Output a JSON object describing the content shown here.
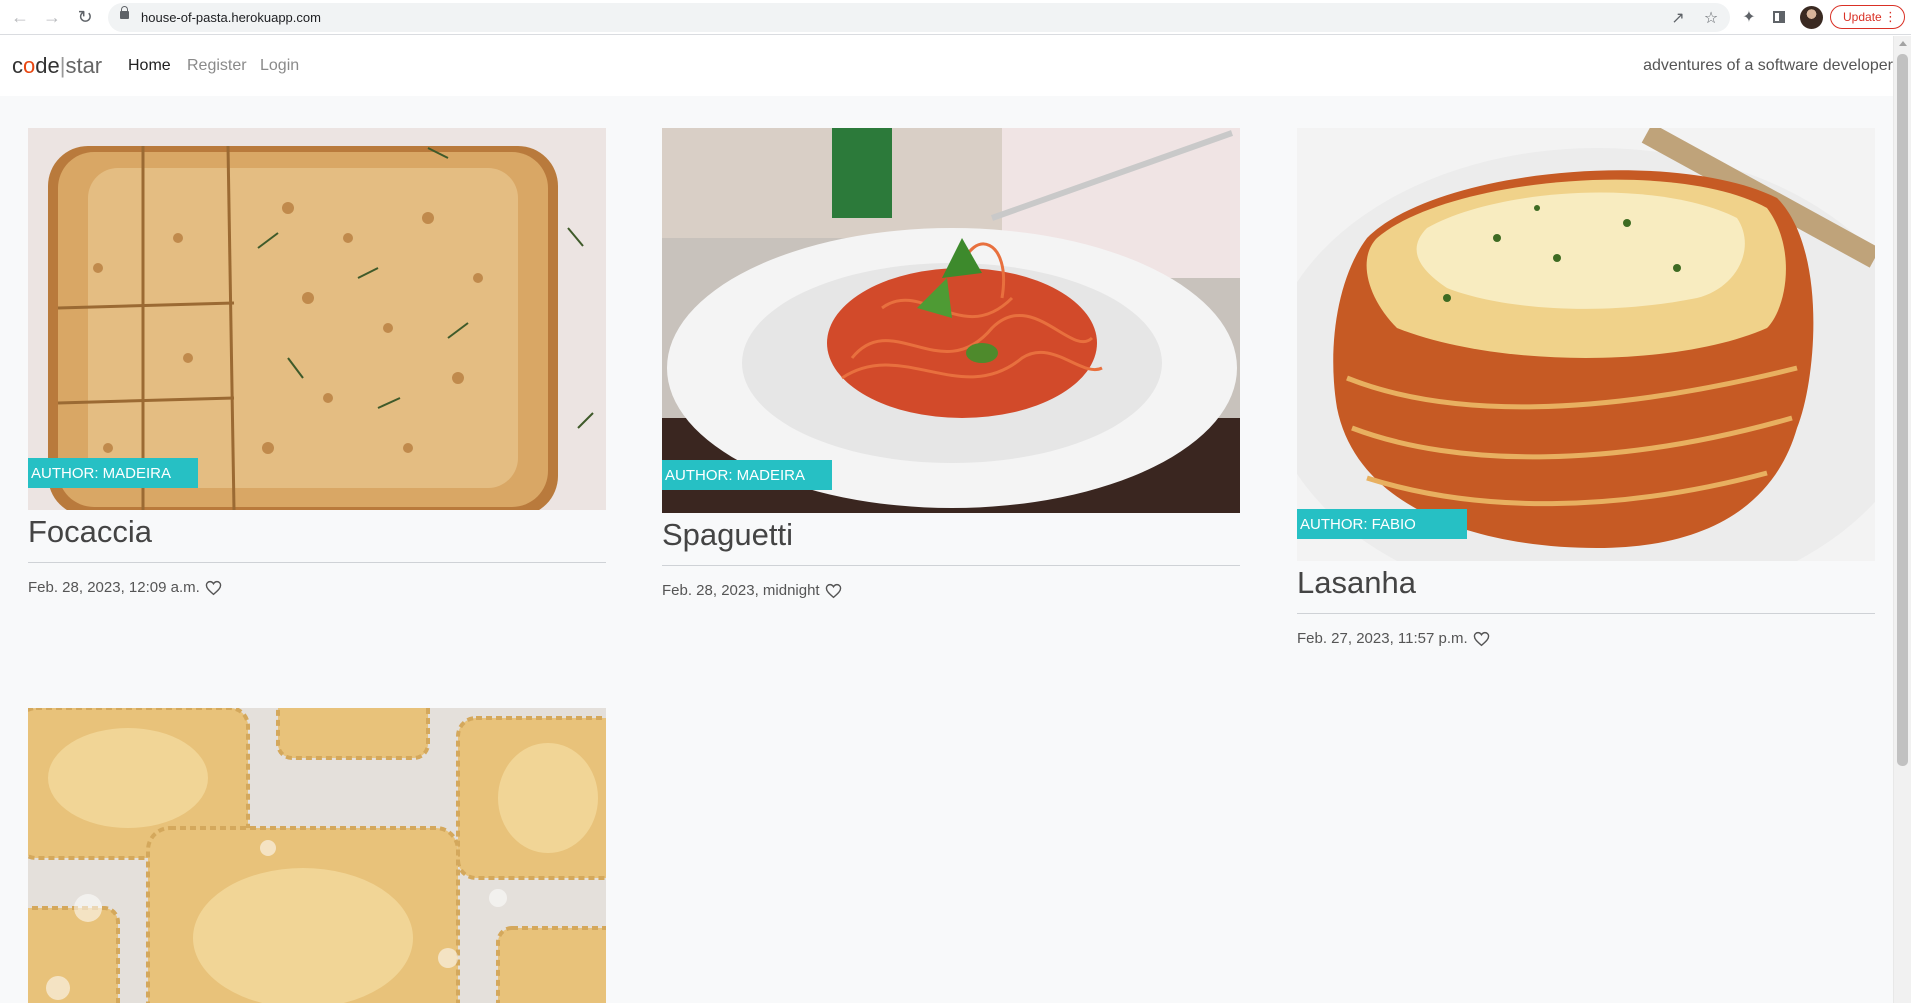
{
  "browser": {
    "url": "house-of-pasta.herokuapp.com",
    "update_label": "Update",
    "update_menu": "⋮"
  },
  "navbar": {
    "brand_code_pre": "c",
    "brand_code_o": "o",
    "brand_code_post": "de",
    "brand_sep": "|",
    "brand_star": "star",
    "links": [
      "Home",
      "Register",
      "Login"
    ],
    "active_link": "Home",
    "tagline": "adventures of a software developer"
  },
  "posts": [
    {
      "author": "Author: MADEIRA",
      "title": "Focaccia",
      "date": "Feb. 28, 2023, 12:09 a.m.",
      "image": "focaccia-bread-photo"
    },
    {
      "author": "Author: MADEIRA",
      "title": "Spaguetti",
      "date": "Feb. 28, 2023, midnight",
      "image": "spaghetti-plate-photo"
    },
    {
      "author": "Author: FABIO",
      "title": "Lasanha",
      "date": "Feb. 27, 2023, 11:57 p.m.",
      "image": "lasagna-slice-photo"
    },
    {
      "author": "",
      "title": "",
      "date": "",
      "image": "ravioli-photo"
    }
  ],
  "colors": {
    "badge": "#26c0c4",
    "page_bg": "#f8f9fa",
    "brand_accent": "#e84610"
  }
}
